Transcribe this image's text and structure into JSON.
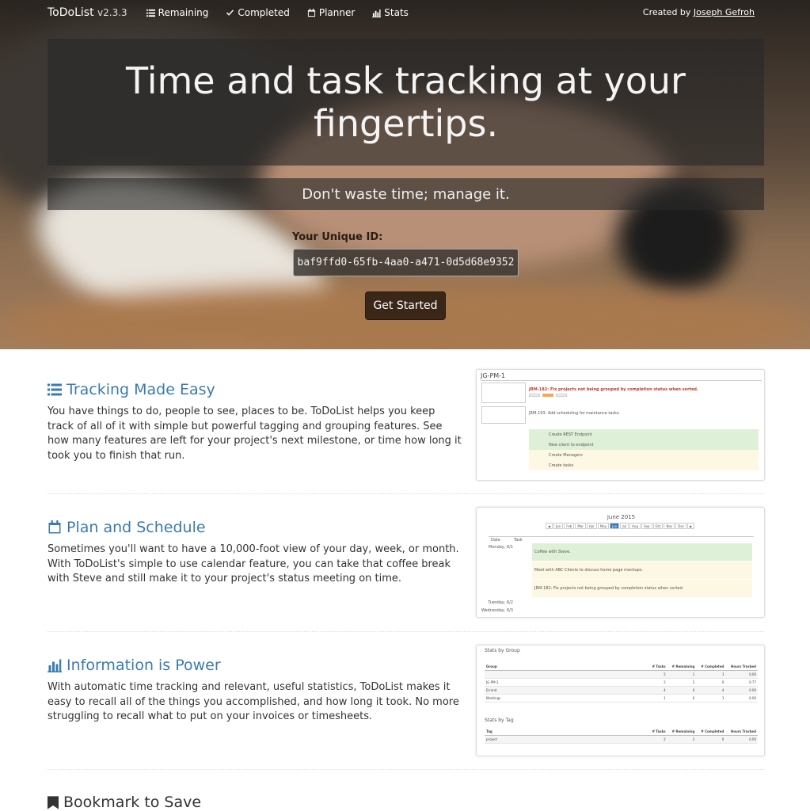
{
  "nav": {
    "brand": "ToDoList",
    "version": "v2.3.3",
    "items": [
      {
        "label": "Remaining",
        "icon": "list-icon"
      },
      {
        "label": "Completed",
        "icon": "check-icon"
      },
      {
        "label": "Planner",
        "icon": "calendar-icon"
      },
      {
        "label": "Stats",
        "icon": "bar-chart-icon"
      }
    ],
    "credit_prefix": "Created by",
    "credit_name": "Joseph Gefroh"
  },
  "hero": {
    "title": "Time and task tracking at your fingertips.",
    "subtitle": "Don't waste time; manage it.",
    "uid_label": "Your Unique ID:",
    "uid_value": "baf9ffd0-65fb-4aa0-a471-0d5d68e9352",
    "cta": "Get Started"
  },
  "features": [
    {
      "title": "Tracking Made Easy",
      "icon": "list-icon",
      "body": "You have things to do, people to see, places to be. ToDoList helps you keep track of all of it with simple but powerful tagging and grouping features. See how many features are left for your project's next milestone, or time how long it took you to finish that run."
    },
    {
      "title": "Plan and Schedule",
      "icon": "calendar-icon",
      "body": "Sometimes you'll want to have a 10,000-foot view of your day, week, or month. With ToDoList's simple to use calendar feature, you can take that coffee break with Steve and still make it to your project's status meeting on time."
    },
    {
      "title": "Information is Power",
      "icon": "bar-chart-icon",
      "body": "With automatic time tracking and relevant, useful statistics, ToDoList makes it easy to recall all of the things you accomplished, and how long it took. No more struggling to recall what to put on your invoices or timesheets."
    }
  ],
  "bookmark": {
    "title": "Bookmark to Save",
    "icon": "bookmark-icon"
  },
  "shot1": {
    "header": "JG-PM-1",
    "task1": "JRM-182: Fix projects not being grouped by completion status when sorted.",
    "task2": "JRM-193: Add scheduling for maintance tasks.",
    "subtasks": [
      "Create REST Endpoint",
      "New client to endpoint",
      "Create Managers",
      "Create tasks"
    ]
  },
  "shot2": {
    "month": "June 2015",
    "months": [
      "Jan",
      "Feb",
      "Mar",
      "Apr",
      "May",
      "Jun",
      "Jul",
      "Aug",
      "Sep",
      "Oct",
      "Nov",
      "Dec"
    ],
    "col_date": "Date",
    "col_task": "Task",
    "day1": "Monday, 6/1",
    "day2": "Tuesday, 6/2",
    "day3": "Wednesday, 6/3",
    "task1": "Coffee with Steve.",
    "task2": "Meet with ABC Clients to discuss home page mockups.",
    "task3": "JRM-182: Fix projects not being grouped by completion status when sorted."
  },
  "shot3": {
    "by_group": "Stats by Group",
    "by_tag": "Stats by Tag",
    "cols": [
      "Group",
      "# Tasks",
      "# Remaining",
      "# Completed",
      "Hours Tracked"
    ],
    "tag_cols": [
      "Tag",
      "# Tasks",
      "# Remaining",
      "# Completed",
      "Hours Tracked"
    ],
    "rows": [
      [
        "",
        "2",
        "1",
        "1",
        "0.00"
      ],
      [
        "JG-PM-1",
        "2",
        "2",
        "0",
        "0.77"
      ],
      [
        "Errand",
        "4",
        "0",
        "4",
        "0.00"
      ],
      [
        "Meetings",
        "1",
        "0",
        "1",
        "0.00"
      ]
    ],
    "tag_rows": [
      [
        "project",
        "2",
        "2",
        "0",
        "0.00"
      ]
    ]
  }
}
